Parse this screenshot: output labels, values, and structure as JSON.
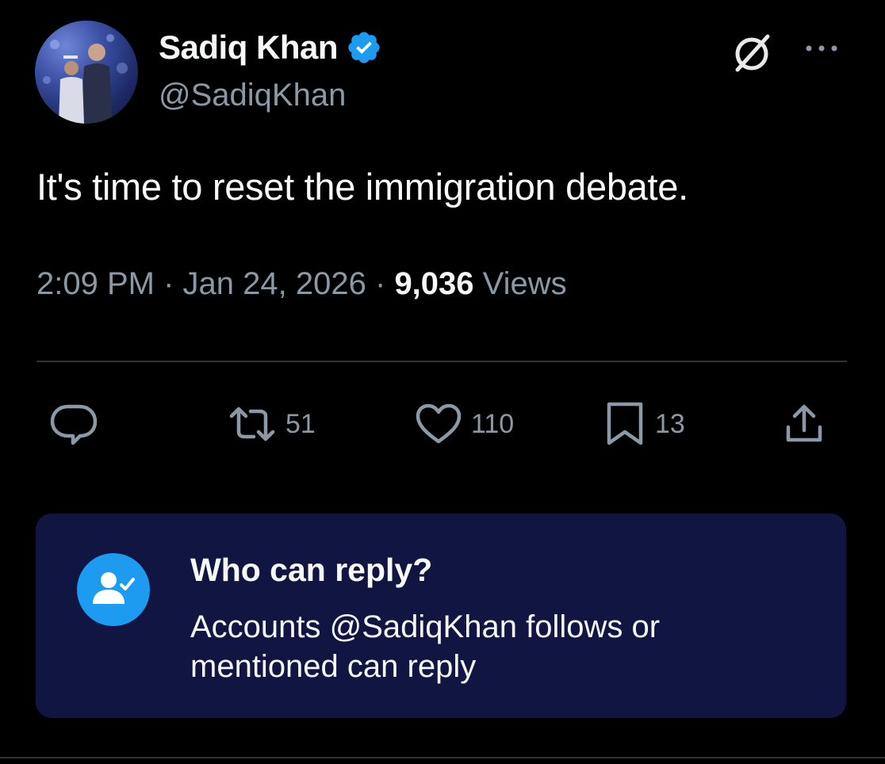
{
  "author": {
    "display_name": "Sadiq Khan",
    "handle": "@SadiqKhan",
    "verified": true,
    "avatar": "profile-photo"
  },
  "tweet": {
    "text": "It's time to reset the immigration debate.",
    "time": "2:09 PM",
    "separator": "·",
    "date": "Jan 24, 2026",
    "views_count": "9,036",
    "views_label": "Views"
  },
  "actions": {
    "reply": {
      "icon": "reply-icon",
      "count": ""
    },
    "retweet": {
      "icon": "retweet-icon",
      "count": "51"
    },
    "like": {
      "icon": "heart-icon",
      "count": "110"
    },
    "bookmark": {
      "icon": "bookmark-icon",
      "count": "13"
    },
    "share": {
      "icon": "share-icon"
    }
  },
  "header_icons": {
    "grok": "grok-icon",
    "more": "more-icon"
  },
  "reply_restriction": {
    "title": "Who can reply?",
    "description": "Accounts @SadiqKhan follows or mentioned can reply",
    "icon": "user-check-icon"
  },
  "colors": {
    "background": "#000000",
    "accent": "#1d9bf0",
    "secondary_text": "#8b98a5",
    "card_background": "#111542"
  }
}
